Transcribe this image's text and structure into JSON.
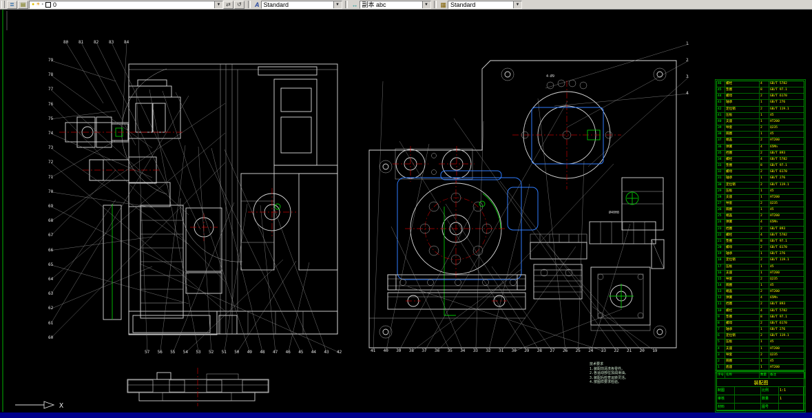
{
  "toolbar": {
    "layer_value": "0",
    "text_style": "Standard",
    "dim_style": "副本 abc",
    "table_style": "Standard"
  },
  "canvas": {
    "ucs_label": "X",
    "notes": [
      "技术要求",
      "1.装配前清洗各零件。",
      "2.各运动部位加润滑油。",
      "3.装配后检查运转灵活。",
      "4.按图样要求检验。"
    ],
    "annotations": [
      {
        "text": "Ø40H8"
      },
      {
        "text": "4-Ø9"
      }
    ],
    "balloons": {
      "left_col": [
        "79",
        "78",
        "77",
        "76",
        "75",
        "74",
        "73",
        "72",
        "71",
        "70",
        "69",
        "68",
        "67",
        "66",
        "65",
        "64",
        "63",
        "62",
        "61",
        "60"
      ],
      "top_left": [
        "80",
        "81",
        "82",
        "83",
        "84"
      ],
      "bottom_left": [
        "57",
        "56",
        "55",
        "54",
        "53",
        "52",
        "51",
        "50",
        "49",
        "48",
        "47",
        "46",
        "45",
        "44",
        "43",
        "42"
      ],
      "bottom_right": [
        "41",
        "40",
        "39",
        "38",
        "37",
        "36",
        "35",
        "34",
        "33",
        "32",
        "31",
        "30",
        "29",
        "28",
        "27",
        "26",
        "25",
        "24",
        "23",
        "22",
        "21",
        "20",
        "19"
      ],
      "top_right": [
        "1",
        "2",
        "3",
        "4"
      ]
    }
  },
  "bom": {
    "headers": [
      "序号",
      "名称",
      "数量",
      "备注"
    ],
    "rows": [
      {
        "n": "46",
        "name": "螺栓",
        "qty": "4",
        "std": "GB/T 5782"
      },
      {
        "n": "45",
        "name": "垫圈",
        "qty": "8",
        "std": "GB/T 97.1"
      },
      {
        "n": "44",
        "name": "螺母",
        "qty": "2",
        "std": "GB/T 6170"
      },
      {
        "n": "43",
        "name": "轴承",
        "qty": "1",
        "std": "GB/T 276"
      },
      {
        "n": "42",
        "name": "定位销",
        "qty": "2",
        "std": "GB/T 119.1"
      },
      {
        "n": "41",
        "name": "压板",
        "qty": "1",
        "std": "45"
      },
      {
        "n": "40",
        "name": "支座",
        "qty": "1",
        "std": "HT200"
      },
      {
        "n": "39",
        "name": "导套",
        "qty": "2",
        "std": "Q235"
      },
      {
        "n": "38",
        "name": "隔圈",
        "qty": "1",
        "std": "45"
      },
      {
        "n": "37",
        "name": "端盖",
        "qty": "2",
        "std": "HT200"
      },
      {
        "n": "36",
        "name": "弹簧",
        "qty": "4",
        "std": "65Mn"
      },
      {
        "n": "35",
        "name": "挡圈",
        "qty": "2",
        "std": "GB/T 893"
      },
      {
        "n": "34",
        "name": "螺栓",
        "qty": "4",
        "std": "GB/T 5782"
      },
      {
        "n": "33",
        "name": "垫圈",
        "qty": "8",
        "std": "GB/T 97.1"
      },
      {
        "n": "32",
        "name": "螺母",
        "qty": "2",
        "std": "GB/T 6170"
      },
      {
        "n": "31",
        "name": "轴承",
        "qty": "1",
        "std": "GB/T 276"
      },
      {
        "n": "30",
        "name": "定位销",
        "qty": "2",
        "std": "GB/T 119.1"
      },
      {
        "n": "29",
        "name": "压板",
        "qty": "1",
        "std": "45"
      },
      {
        "n": "28",
        "name": "支座",
        "qty": "1",
        "std": "HT200"
      },
      {
        "n": "27",
        "name": "导套",
        "qty": "2",
        "std": "Q235"
      },
      {
        "n": "26",
        "name": "隔圈",
        "qty": "1",
        "std": "45"
      },
      {
        "n": "25",
        "name": "端盖",
        "qty": "2",
        "std": "HT200"
      },
      {
        "n": "24",
        "name": "弹簧",
        "qty": "4",
        "std": "65Mn"
      },
      {
        "n": "23",
        "name": "挡圈",
        "qty": "2",
        "std": "GB/T 893"
      },
      {
        "n": "22",
        "name": "螺栓",
        "qty": "4",
        "std": "GB/T 5782"
      },
      {
        "n": "21",
        "name": "垫圈",
        "qty": "8",
        "std": "GB/T 97.1"
      },
      {
        "n": "20",
        "name": "螺母",
        "qty": "2",
        "std": "GB/T 6170"
      },
      {
        "n": "19",
        "name": "轴承",
        "qty": "1",
        "std": "GB/T 276"
      },
      {
        "n": "18",
        "name": "定位销",
        "qty": "2",
        "std": "GB/T 119.1"
      },
      {
        "n": "17",
        "name": "压板",
        "qty": "1",
        "std": "45"
      },
      {
        "n": "16",
        "name": "支座",
        "qty": "1",
        "std": "HT200"
      },
      {
        "n": "15",
        "name": "导套",
        "qty": "2",
        "std": "Q235"
      },
      {
        "n": "14",
        "name": "隔圈",
        "qty": "1",
        "std": "45"
      },
      {
        "n": "13",
        "name": "端盖",
        "qty": "2",
        "std": "HT200"
      },
      {
        "n": "12",
        "name": "弹簧",
        "qty": "4",
        "std": "65Mn"
      },
      {
        "n": "11",
        "name": "挡圈",
        "qty": "2",
        "std": "GB/T 893"
      },
      {
        "n": "10",
        "name": "螺栓",
        "qty": "4",
        "std": "GB/T 5782"
      },
      {
        "n": "9",
        "name": "垫圈",
        "qty": "8",
        "std": "GB/T 97.1"
      },
      {
        "n": "8",
        "name": "螺母",
        "qty": "2",
        "std": "GB/T 6170"
      },
      {
        "n": "7",
        "name": "轴承",
        "qty": "1",
        "std": "GB/T 276"
      },
      {
        "n": "6",
        "name": "定位销",
        "qty": "2",
        "std": "GB/T 119.1"
      },
      {
        "n": "5",
        "name": "压板",
        "qty": "1",
        "std": "45"
      },
      {
        "n": "4",
        "name": "支座",
        "qty": "1",
        "std": "HT200"
      },
      {
        "n": "3",
        "name": "导套",
        "qty": "2",
        "std": "Q235"
      },
      {
        "n": "2",
        "name": "隔圈",
        "qty": "1",
        "std": "45"
      },
      {
        "n": "1",
        "name": "底座",
        "qty": "1",
        "std": "HT200"
      }
    ],
    "title_block": {
      "title": "装配图",
      "drawn_label": "制图",
      "check_label": "审核",
      "material_label": "材料",
      "scale_label": "比例",
      "scale": "1:1",
      "qty_label": "数量",
      "qty": "1",
      "no_label": "图号"
    }
  }
}
